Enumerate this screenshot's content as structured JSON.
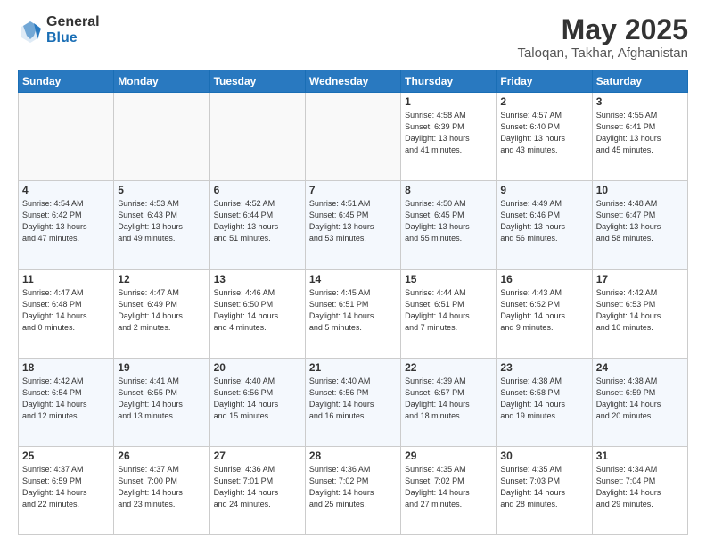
{
  "logo": {
    "general": "General",
    "blue": "Blue"
  },
  "title": "May 2025",
  "subtitle": "Taloqan, Takhar, Afghanistan",
  "days_of_week": [
    "Sunday",
    "Monday",
    "Tuesday",
    "Wednesday",
    "Thursday",
    "Friday",
    "Saturday"
  ],
  "weeks": [
    [
      {
        "day": "",
        "info": ""
      },
      {
        "day": "",
        "info": ""
      },
      {
        "day": "",
        "info": ""
      },
      {
        "day": "",
        "info": ""
      },
      {
        "day": "1",
        "info": "Sunrise: 4:58 AM\nSunset: 6:39 PM\nDaylight: 13 hours\nand 41 minutes."
      },
      {
        "day": "2",
        "info": "Sunrise: 4:57 AM\nSunset: 6:40 PM\nDaylight: 13 hours\nand 43 minutes."
      },
      {
        "day": "3",
        "info": "Sunrise: 4:55 AM\nSunset: 6:41 PM\nDaylight: 13 hours\nand 45 minutes."
      }
    ],
    [
      {
        "day": "4",
        "info": "Sunrise: 4:54 AM\nSunset: 6:42 PM\nDaylight: 13 hours\nand 47 minutes."
      },
      {
        "day": "5",
        "info": "Sunrise: 4:53 AM\nSunset: 6:43 PM\nDaylight: 13 hours\nand 49 minutes."
      },
      {
        "day": "6",
        "info": "Sunrise: 4:52 AM\nSunset: 6:44 PM\nDaylight: 13 hours\nand 51 minutes."
      },
      {
        "day": "7",
        "info": "Sunrise: 4:51 AM\nSunset: 6:45 PM\nDaylight: 13 hours\nand 53 minutes."
      },
      {
        "day": "8",
        "info": "Sunrise: 4:50 AM\nSunset: 6:45 PM\nDaylight: 13 hours\nand 55 minutes."
      },
      {
        "day": "9",
        "info": "Sunrise: 4:49 AM\nSunset: 6:46 PM\nDaylight: 13 hours\nand 56 minutes."
      },
      {
        "day": "10",
        "info": "Sunrise: 4:48 AM\nSunset: 6:47 PM\nDaylight: 13 hours\nand 58 minutes."
      }
    ],
    [
      {
        "day": "11",
        "info": "Sunrise: 4:47 AM\nSunset: 6:48 PM\nDaylight: 14 hours\nand 0 minutes."
      },
      {
        "day": "12",
        "info": "Sunrise: 4:47 AM\nSunset: 6:49 PM\nDaylight: 14 hours\nand 2 minutes."
      },
      {
        "day": "13",
        "info": "Sunrise: 4:46 AM\nSunset: 6:50 PM\nDaylight: 14 hours\nand 4 minutes."
      },
      {
        "day": "14",
        "info": "Sunrise: 4:45 AM\nSunset: 6:51 PM\nDaylight: 14 hours\nand 5 minutes."
      },
      {
        "day": "15",
        "info": "Sunrise: 4:44 AM\nSunset: 6:51 PM\nDaylight: 14 hours\nand 7 minutes."
      },
      {
        "day": "16",
        "info": "Sunrise: 4:43 AM\nSunset: 6:52 PM\nDaylight: 14 hours\nand 9 minutes."
      },
      {
        "day": "17",
        "info": "Sunrise: 4:42 AM\nSunset: 6:53 PM\nDaylight: 14 hours\nand 10 minutes."
      }
    ],
    [
      {
        "day": "18",
        "info": "Sunrise: 4:42 AM\nSunset: 6:54 PM\nDaylight: 14 hours\nand 12 minutes."
      },
      {
        "day": "19",
        "info": "Sunrise: 4:41 AM\nSunset: 6:55 PM\nDaylight: 14 hours\nand 13 minutes."
      },
      {
        "day": "20",
        "info": "Sunrise: 4:40 AM\nSunset: 6:56 PM\nDaylight: 14 hours\nand 15 minutes."
      },
      {
        "day": "21",
        "info": "Sunrise: 4:40 AM\nSunset: 6:56 PM\nDaylight: 14 hours\nand 16 minutes."
      },
      {
        "day": "22",
        "info": "Sunrise: 4:39 AM\nSunset: 6:57 PM\nDaylight: 14 hours\nand 18 minutes."
      },
      {
        "day": "23",
        "info": "Sunrise: 4:38 AM\nSunset: 6:58 PM\nDaylight: 14 hours\nand 19 minutes."
      },
      {
        "day": "24",
        "info": "Sunrise: 4:38 AM\nSunset: 6:59 PM\nDaylight: 14 hours\nand 20 minutes."
      }
    ],
    [
      {
        "day": "25",
        "info": "Sunrise: 4:37 AM\nSunset: 6:59 PM\nDaylight: 14 hours\nand 22 minutes."
      },
      {
        "day": "26",
        "info": "Sunrise: 4:37 AM\nSunset: 7:00 PM\nDaylight: 14 hours\nand 23 minutes."
      },
      {
        "day": "27",
        "info": "Sunrise: 4:36 AM\nSunset: 7:01 PM\nDaylight: 14 hours\nand 24 minutes."
      },
      {
        "day": "28",
        "info": "Sunrise: 4:36 AM\nSunset: 7:02 PM\nDaylight: 14 hours\nand 25 minutes."
      },
      {
        "day": "29",
        "info": "Sunrise: 4:35 AM\nSunset: 7:02 PM\nDaylight: 14 hours\nand 27 minutes."
      },
      {
        "day": "30",
        "info": "Sunrise: 4:35 AM\nSunset: 7:03 PM\nDaylight: 14 hours\nand 28 minutes."
      },
      {
        "day": "31",
        "info": "Sunrise: 4:34 AM\nSunset: 7:04 PM\nDaylight: 14 hours\nand 29 minutes."
      }
    ]
  ]
}
